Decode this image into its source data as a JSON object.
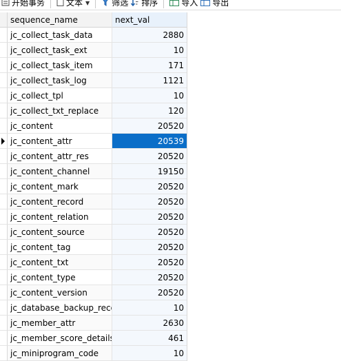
{
  "toolbar": {
    "begin_transaction": "开始事务",
    "text": "文本",
    "filter": "筛选",
    "sort": "排序",
    "import": "导入",
    "export": "导出"
  },
  "grid": {
    "columns": [
      "sequence_name",
      "next_val"
    ],
    "selected_row_index": 7,
    "rows": [
      {
        "sequence_name": "jc_collect_task_data",
        "next_val": "2880"
      },
      {
        "sequence_name": "jc_collect_task_ext",
        "next_val": "10"
      },
      {
        "sequence_name": "jc_collect_task_item",
        "next_val": "171"
      },
      {
        "sequence_name": "jc_collect_task_log",
        "next_val": "1121"
      },
      {
        "sequence_name": "jc_collect_tpl",
        "next_val": "10"
      },
      {
        "sequence_name": "jc_collect_txt_replace",
        "next_val": "120"
      },
      {
        "sequence_name": "jc_content",
        "next_val": "20520"
      },
      {
        "sequence_name": "jc_content_attr",
        "next_val": "20539"
      },
      {
        "sequence_name": "jc_content_attr_res",
        "next_val": "20520"
      },
      {
        "sequence_name": "jc_content_channel",
        "next_val": "19150"
      },
      {
        "sequence_name": "jc_content_mark",
        "next_val": "20520"
      },
      {
        "sequence_name": "jc_content_record",
        "next_val": "20520"
      },
      {
        "sequence_name": "jc_content_relation",
        "next_val": "20520"
      },
      {
        "sequence_name": "jc_content_source",
        "next_val": "20520"
      },
      {
        "sequence_name": "jc_content_tag",
        "next_val": "20520"
      },
      {
        "sequence_name": "jc_content_txt",
        "next_val": "20520"
      },
      {
        "sequence_name": "jc_content_type",
        "next_val": "20520"
      },
      {
        "sequence_name": "jc_content_version",
        "next_val": "20520"
      },
      {
        "sequence_name": "jc_database_backup_reco",
        "next_val": "10"
      },
      {
        "sequence_name": "jc_member_attr",
        "next_val": "2630"
      },
      {
        "sequence_name": "jc_member_score_details",
        "next_val": "461"
      },
      {
        "sequence_name": "jc_miniprogram_code",
        "next_val": "10"
      }
    ]
  }
}
